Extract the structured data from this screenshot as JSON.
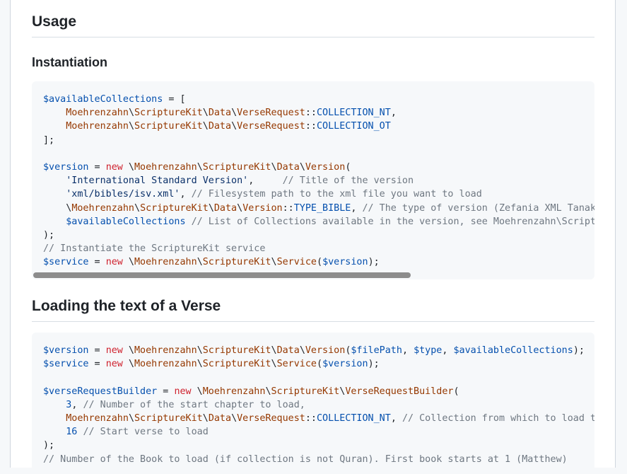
{
  "sections": {
    "usage_heading": "Usage",
    "instantiation_heading": "Instantiation",
    "loading_heading": "Loading the text of a Verse"
  },
  "code_block_1": {
    "lines": [
      [
        [
          "v",
          "$availableCollections"
        ],
        [
          "p",
          " = ["
        ]
      ],
      [
        [
          "p",
          "    "
        ],
        [
          "c",
          "Moehrenzahn"
        ],
        [
          "p",
          "\\"
        ],
        [
          "c",
          "ScriptureKit"
        ],
        [
          "p",
          "\\"
        ],
        [
          "c",
          "Data"
        ],
        [
          "p",
          "\\"
        ],
        [
          "c",
          "VerseRequest"
        ],
        [
          "p",
          "::"
        ],
        [
          "v",
          "COLLECTION_NT"
        ],
        [
          "p",
          ","
        ]
      ],
      [
        [
          "p",
          "    "
        ],
        [
          "c",
          "Moehrenzahn"
        ],
        [
          "p",
          "\\"
        ],
        [
          "c",
          "ScriptureKit"
        ],
        [
          "p",
          "\\"
        ],
        [
          "c",
          "Data"
        ],
        [
          "p",
          "\\"
        ],
        [
          "c",
          "VerseRequest"
        ],
        [
          "p",
          "::"
        ],
        [
          "v",
          "COLLECTION_OT"
        ]
      ],
      [
        [
          "p",
          "];"
        ]
      ],
      [
        [
          "p",
          ""
        ]
      ],
      [
        [
          "v",
          "$version"
        ],
        [
          "p",
          " = "
        ],
        [
          "k",
          "new"
        ],
        [
          "p",
          " \\"
        ],
        [
          "c",
          "Moehrenzahn"
        ],
        [
          "p",
          "\\"
        ],
        [
          "c",
          "ScriptureKit"
        ],
        [
          "p",
          "\\"
        ],
        [
          "c",
          "Data"
        ],
        [
          "p",
          "\\"
        ],
        [
          "c",
          "Version"
        ],
        [
          "p",
          "("
        ]
      ],
      [
        [
          "p",
          "    "
        ],
        [
          "s",
          "'International Standard Version'"
        ],
        [
          "p",
          ",     "
        ],
        [
          "m",
          "// Title of the version"
        ]
      ],
      [
        [
          "p",
          "    "
        ],
        [
          "s",
          "'xml/bibles/isv.xml'"
        ],
        [
          "p",
          ", "
        ],
        [
          "m",
          "// Filesystem path to the xml file you want to load"
        ]
      ],
      [
        [
          "p",
          "    \\"
        ],
        [
          "c",
          "Moehrenzahn"
        ],
        [
          "p",
          "\\"
        ],
        [
          "c",
          "ScriptureKit"
        ],
        [
          "p",
          "\\"
        ],
        [
          "c",
          "Data"
        ],
        [
          "p",
          "\\"
        ],
        [
          "c",
          "Version"
        ],
        [
          "p",
          "::"
        ],
        [
          "v",
          "TYPE_BIBLE"
        ],
        [
          "p",
          ", "
        ],
        [
          "m",
          "// The type of version (Zefania XML Tanakh"
        ]
      ],
      [
        [
          "p",
          "    "
        ],
        [
          "v",
          "$availableCollections"
        ],
        [
          "p",
          " "
        ],
        [
          "m",
          "// List of Collections available in the version, see Moehrenzahn\\Script"
        ]
      ],
      [
        [
          "p",
          ");"
        ]
      ],
      [
        [
          "m",
          "// Instantiate the ScriptureKit service"
        ]
      ],
      [
        [
          "v",
          "$service"
        ],
        [
          "p",
          " = "
        ],
        [
          "k",
          "new"
        ],
        [
          "p",
          " \\"
        ],
        [
          "c",
          "Moehrenzahn"
        ],
        [
          "p",
          "\\"
        ],
        [
          "c",
          "ScriptureKit"
        ],
        [
          "p",
          "\\"
        ],
        [
          "c",
          "Service"
        ],
        [
          "p",
          "("
        ],
        [
          "v",
          "$version"
        ],
        [
          "p",
          ");"
        ]
      ]
    ]
  },
  "code_block_2": {
    "lines": [
      [
        [
          "v",
          "$version"
        ],
        [
          "p",
          " = "
        ],
        [
          "k",
          "new"
        ],
        [
          "p",
          " \\"
        ],
        [
          "c",
          "Moehrenzahn"
        ],
        [
          "p",
          "\\"
        ],
        [
          "c",
          "ScriptureKit"
        ],
        [
          "p",
          "\\"
        ],
        [
          "c",
          "Data"
        ],
        [
          "p",
          "\\"
        ],
        [
          "c",
          "Version"
        ],
        [
          "p",
          "("
        ],
        [
          "v",
          "$filePath"
        ],
        [
          "p",
          ", "
        ],
        [
          "v",
          "$type"
        ],
        [
          "p",
          ", "
        ],
        [
          "v",
          "$availableCollections"
        ],
        [
          "p",
          ");"
        ]
      ],
      [
        [
          "v",
          "$service"
        ],
        [
          "p",
          " = "
        ],
        [
          "k",
          "new"
        ],
        [
          "p",
          " \\"
        ],
        [
          "c",
          "Moehrenzahn"
        ],
        [
          "p",
          "\\"
        ],
        [
          "c",
          "ScriptureKit"
        ],
        [
          "p",
          "\\"
        ],
        [
          "c",
          "Service"
        ],
        [
          "p",
          "("
        ],
        [
          "v",
          "$version"
        ],
        [
          "p",
          ");"
        ]
      ],
      [
        [
          "p",
          ""
        ]
      ],
      [
        [
          "v",
          "$verseRequestBuilder"
        ],
        [
          "p",
          " = "
        ],
        [
          "k",
          "new"
        ],
        [
          "p",
          " \\"
        ],
        [
          "c",
          "Moehrenzahn"
        ],
        [
          "p",
          "\\"
        ],
        [
          "c",
          "ScriptureKit"
        ],
        [
          "p",
          "\\"
        ],
        [
          "c",
          "VerseRequestBuilder"
        ],
        [
          "p",
          "("
        ]
      ],
      [
        [
          "p",
          "    "
        ],
        [
          "n",
          "3"
        ],
        [
          "p",
          ", "
        ],
        [
          "m",
          "// Number of the start chapter to load,"
        ]
      ],
      [
        [
          "p",
          "    "
        ],
        [
          "c",
          "Moehrenzahn"
        ],
        [
          "p",
          "\\"
        ],
        [
          "c",
          "ScriptureKit"
        ],
        [
          "p",
          "\\"
        ],
        [
          "c",
          "Data"
        ],
        [
          "p",
          "\\"
        ],
        [
          "c",
          "VerseRequest"
        ],
        [
          "p",
          "::"
        ],
        [
          "v",
          "COLLECTION_NT"
        ],
        [
          "p",
          ", "
        ],
        [
          "m",
          "// Collection from which to load t"
        ]
      ],
      [
        [
          "p",
          "    "
        ],
        [
          "n",
          "16"
        ],
        [
          "p",
          " "
        ],
        [
          "m",
          "// Start verse to load"
        ]
      ],
      [
        [
          "p",
          ");"
        ]
      ],
      [
        [
          "m",
          "// Number of the Book to load (if collection is not Quran). First book starts at 1 (Matthew)"
        ]
      ]
    ]
  },
  "colors": {
    "variable": "#0550ae",
    "keyword": "#cf222e",
    "class": "#953800",
    "string": "#0a3069",
    "comment": "#6e7781"
  }
}
